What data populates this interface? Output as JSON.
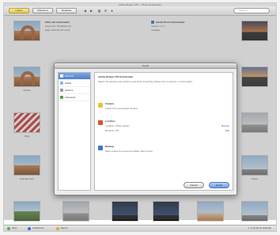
{
  "window": {
    "title": "Adobe Bridge CS5 — Photo Downloader"
  },
  "toolbar": {
    "buttons": [
      "Library",
      "Slideshow",
      "Metadata"
    ],
    "search_placeholder": "Search"
  },
  "thumbnails": {
    "labels": [
      "Arches",
      "Arches",
      "Flag",
      "Delicate Arch",
      "Colorado",
      "Bryce",
      "Tower",
      "Sunset"
    ]
  },
  "info_panel": {
    "line1": "1000_Get downloader",
    "line2": "Keywords: Metadata Info",
    "line3": "Date: 2010-03-05 10:21",
    "right_title": "Adobe Photo Downloader",
    "right_line1": "Version 1.0.1",
    "right_line2": "Installed"
  },
  "dialog": {
    "title": "Import",
    "sidebar": [
      "Sources",
      "Folder",
      "Options",
      "Advanced"
    ],
    "heading": "Adobe Bridge CS5 Downloader",
    "subheading": "Select the devices and options used when importing photos from a camera or card reader.",
    "section1_label": "Camera",
    "section1_desc": "Import from connected camera",
    "section2_label": "Location",
    "section2_row1": "Location: Photo Library",
    "section2_row2": "Rename: Off",
    "section3_label": "Backup",
    "section3_desc": "Save copies to a second location after import",
    "link1": "Browse",
    "link2": "Edit",
    "cancel": "Cancel",
    "ok": "Import"
  },
  "statusbar": {
    "items": [
      "Filter",
      "Collections",
      "Export"
    ],
    "right": "1 of 23 items selected"
  },
  "colors": {
    "accent": "#e6c84a",
    "selection": "#4f7fcc",
    "link": "#2a5db0"
  }
}
